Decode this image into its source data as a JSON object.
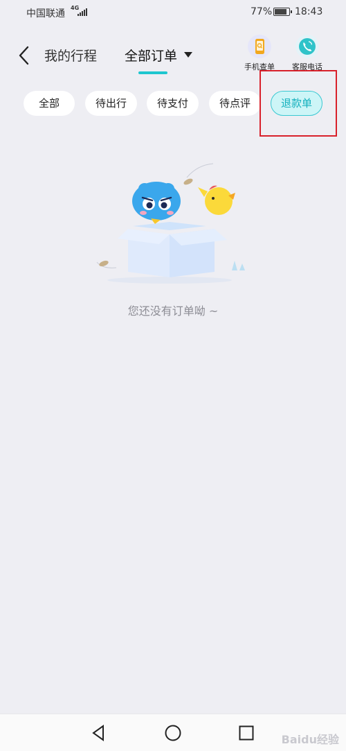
{
  "status_bar": {
    "carrier": "中国联通",
    "network": "4G",
    "battery": "77%",
    "battery_level": 0.77,
    "time": "18:43"
  },
  "header": {
    "back_icon": "chevron-left-icon",
    "title": "我的行程",
    "active_tab": "全部订单",
    "actions": [
      {
        "label": "手机查单",
        "icon": "phone-search-icon",
        "color": "#f2a81e"
      },
      {
        "label": "客服电话",
        "icon": "headset-call-icon",
        "color": "#2fc3c9"
      }
    ],
    "accent_color": "#1ec6cf"
  },
  "filters": {
    "chips": [
      "全部",
      "待出行",
      "待支付",
      "待点评",
      "退款单"
    ],
    "selected": "退款单"
  },
  "empty_state": {
    "message": "您还没有订单呦 ~"
  },
  "watermark": "Baidu经验"
}
